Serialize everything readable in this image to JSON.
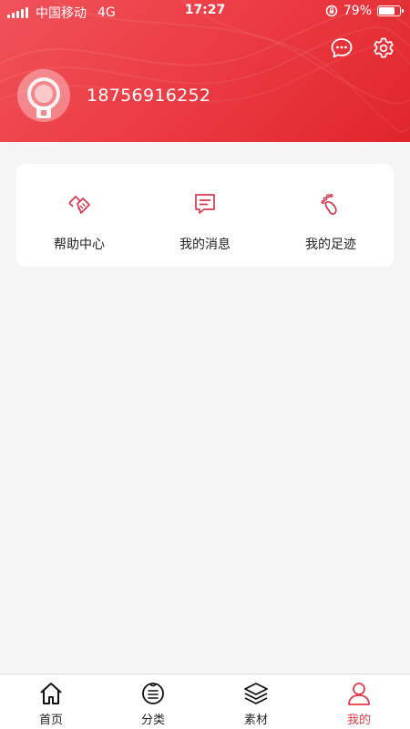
{
  "status_bar": {
    "carrier": "中国移动",
    "network": "4G",
    "time": "17:27",
    "battery_percent": "79%",
    "battery_level": 0.79
  },
  "header": {
    "phone": "18756916252",
    "message_icon": "message-dots-icon",
    "settings_icon": "gear-icon",
    "accent_color": "#e8333c"
  },
  "card": {
    "items": [
      {
        "label": "帮助中心",
        "icon": "handshake-icon"
      },
      {
        "label": "我的消息",
        "icon": "message-list-icon"
      },
      {
        "label": "我的足迹",
        "icon": "footprint-icon"
      }
    ],
    "icon_color": "#d6384f"
  },
  "tabbar": {
    "tabs": [
      {
        "label": "首页",
        "icon": "home-icon"
      },
      {
        "label": "分类",
        "icon": "category-icon"
      },
      {
        "label": "素材",
        "icon": "layers-icon"
      },
      {
        "label": "我的",
        "icon": "user-icon"
      }
    ],
    "active_index": 3,
    "active_color": "#e23a48"
  }
}
